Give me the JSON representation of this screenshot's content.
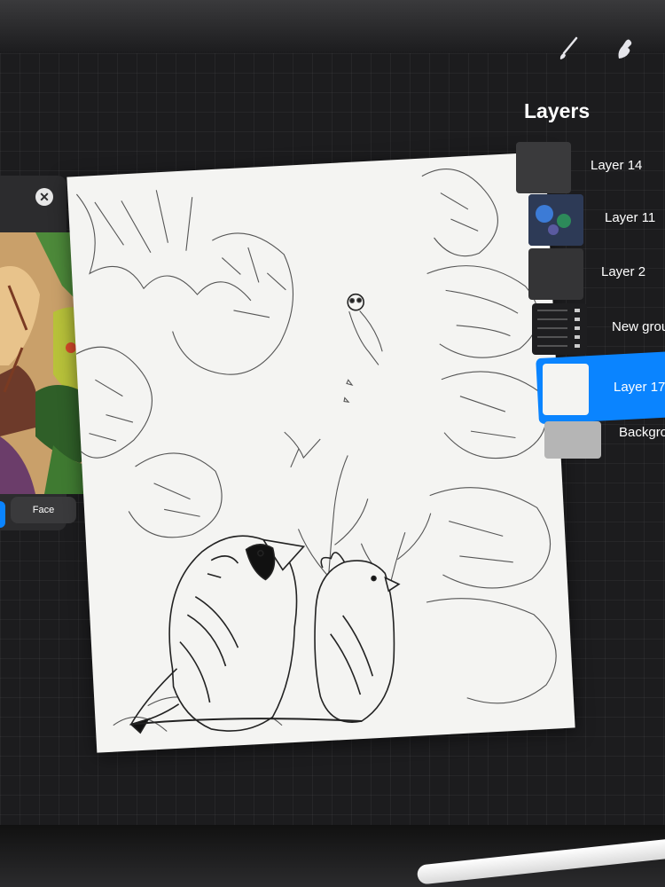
{
  "toolbar": {
    "brush_icon": "brush-icon",
    "smudge_icon": "smudge-icon"
  },
  "reference": {
    "close_symbol": "✕",
    "face_label": "Face"
  },
  "layers": {
    "title": "Layers",
    "items": [
      {
        "label": "Layer 14",
        "selected": false
      },
      {
        "label": "Layer 11",
        "selected": false
      },
      {
        "label": "Layer 2",
        "selected": false
      },
      {
        "label": "New grou",
        "selected": false
      },
      {
        "label": "Layer 17",
        "selected": true
      },
      {
        "label": "Backgro",
        "selected": false
      }
    ]
  },
  "colors": {
    "accent": "#0a84ff",
    "panel": "#2c2c2e",
    "screen": "#1c1c1e",
    "canvas": "#f4f4f2"
  }
}
